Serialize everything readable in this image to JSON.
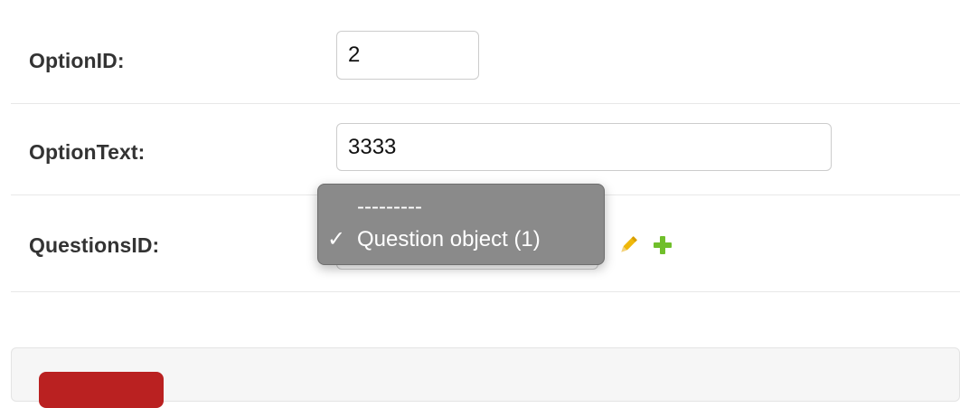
{
  "form": {
    "option_id": {
      "label": "OptionID:",
      "value": "2"
    },
    "option_text": {
      "label": "OptionText:",
      "value": "3333"
    },
    "questions_id": {
      "label": "QuestionsID:",
      "options": [
        "---------",
        "Question object (1)"
      ],
      "selected_index": 1
    }
  },
  "related_actions": {
    "edit_icon": "pencil-icon",
    "add_icon": "plus-icon",
    "edit_color": "#efb80b",
    "add_color": "#70bf2b"
  },
  "dropdown": {
    "checkmark": "✓",
    "background": "#8a8a8a"
  },
  "submit_row": {
    "delete_color": "#ba2121"
  }
}
